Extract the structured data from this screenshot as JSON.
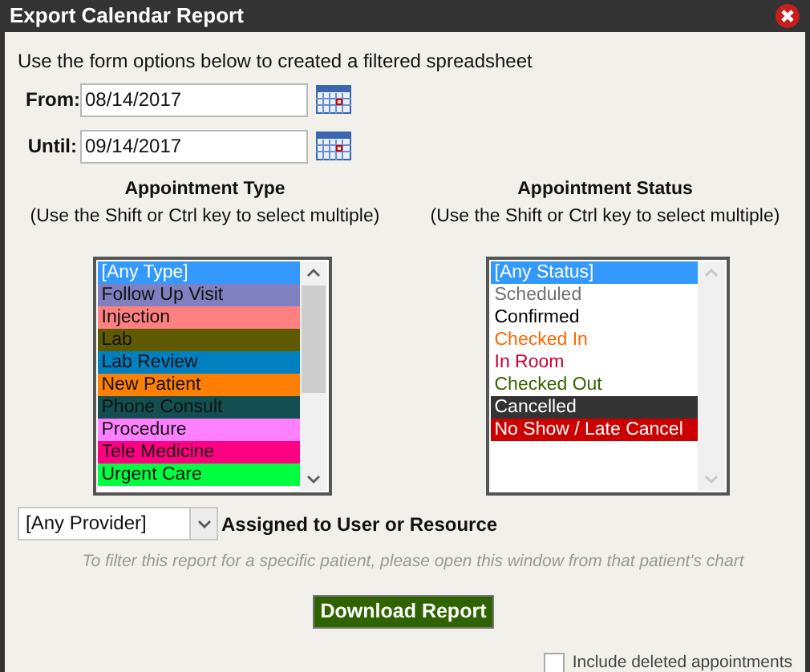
{
  "window": {
    "title": "Export Calendar Report"
  },
  "intro": "Use the form options below to created a filtered spreadsheet",
  "from": {
    "label": "From:",
    "value": "08/14/2017"
  },
  "until": {
    "label": "Until:",
    "value": "09/14/2017"
  },
  "type_list": {
    "title": "Appointment Type",
    "hint": "(Use the Shift or Ctrl key to select multiple)",
    "items": [
      {
        "label": "[Any Type]",
        "selected": true
      },
      {
        "label": "Follow Up Visit",
        "selected": false,
        "color": "#8080c0"
      },
      {
        "label": "Injection",
        "selected": false,
        "color": "#ff8080"
      },
      {
        "label": "Lab",
        "selected": false,
        "color": "#5f5a00"
      },
      {
        "label": "Lab Review",
        "selected": false,
        "color": "#0080c0"
      },
      {
        "label": "New Patient",
        "selected": false,
        "color": "#ff8000"
      },
      {
        "label": "Phone Consult",
        "selected": false,
        "color": "#134f50"
      },
      {
        "label": "Procedure",
        "selected": false,
        "color": "#ff80ff"
      },
      {
        "label": "Tele Medicine",
        "selected": false,
        "color": "#ff0080"
      },
      {
        "label": "Urgent Care",
        "selected": false,
        "color": "#00ff40"
      }
    ]
  },
  "status_list": {
    "title": "Appointment Status",
    "hint": "(Use the Shift or Ctrl key to select multiple)",
    "items": [
      {
        "label": "[Any Status]",
        "selected": true
      },
      {
        "label": "Scheduled",
        "selected": false,
        "kind": "text",
        "color": "#707070"
      },
      {
        "label": "Confirmed",
        "selected": false,
        "kind": "text",
        "color": "#000000"
      },
      {
        "label": "Checked In",
        "selected": false,
        "kind": "text",
        "color": "#ff6600"
      },
      {
        "label": "In Room",
        "selected": false,
        "kind": "text",
        "color": "#cc0033"
      },
      {
        "label": "Checked Out",
        "selected": false,
        "kind": "text",
        "color": "#336600"
      },
      {
        "label": "Cancelled",
        "selected": false,
        "kind": "filled",
        "color": "#333333"
      },
      {
        "label": "No Show / Late Cancel",
        "selected": false,
        "kind": "filled",
        "color": "#cc0000"
      }
    ]
  },
  "provider": {
    "value": "[Any Provider]",
    "label": "Assigned to User or Resource"
  },
  "note": "To filter this report for a specific patient, please open this window from that patient's chart",
  "download_button": "Download Report",
  "include_deleted": {
    "label": "Include deleted appointments",
    "checked": false
  }
}
